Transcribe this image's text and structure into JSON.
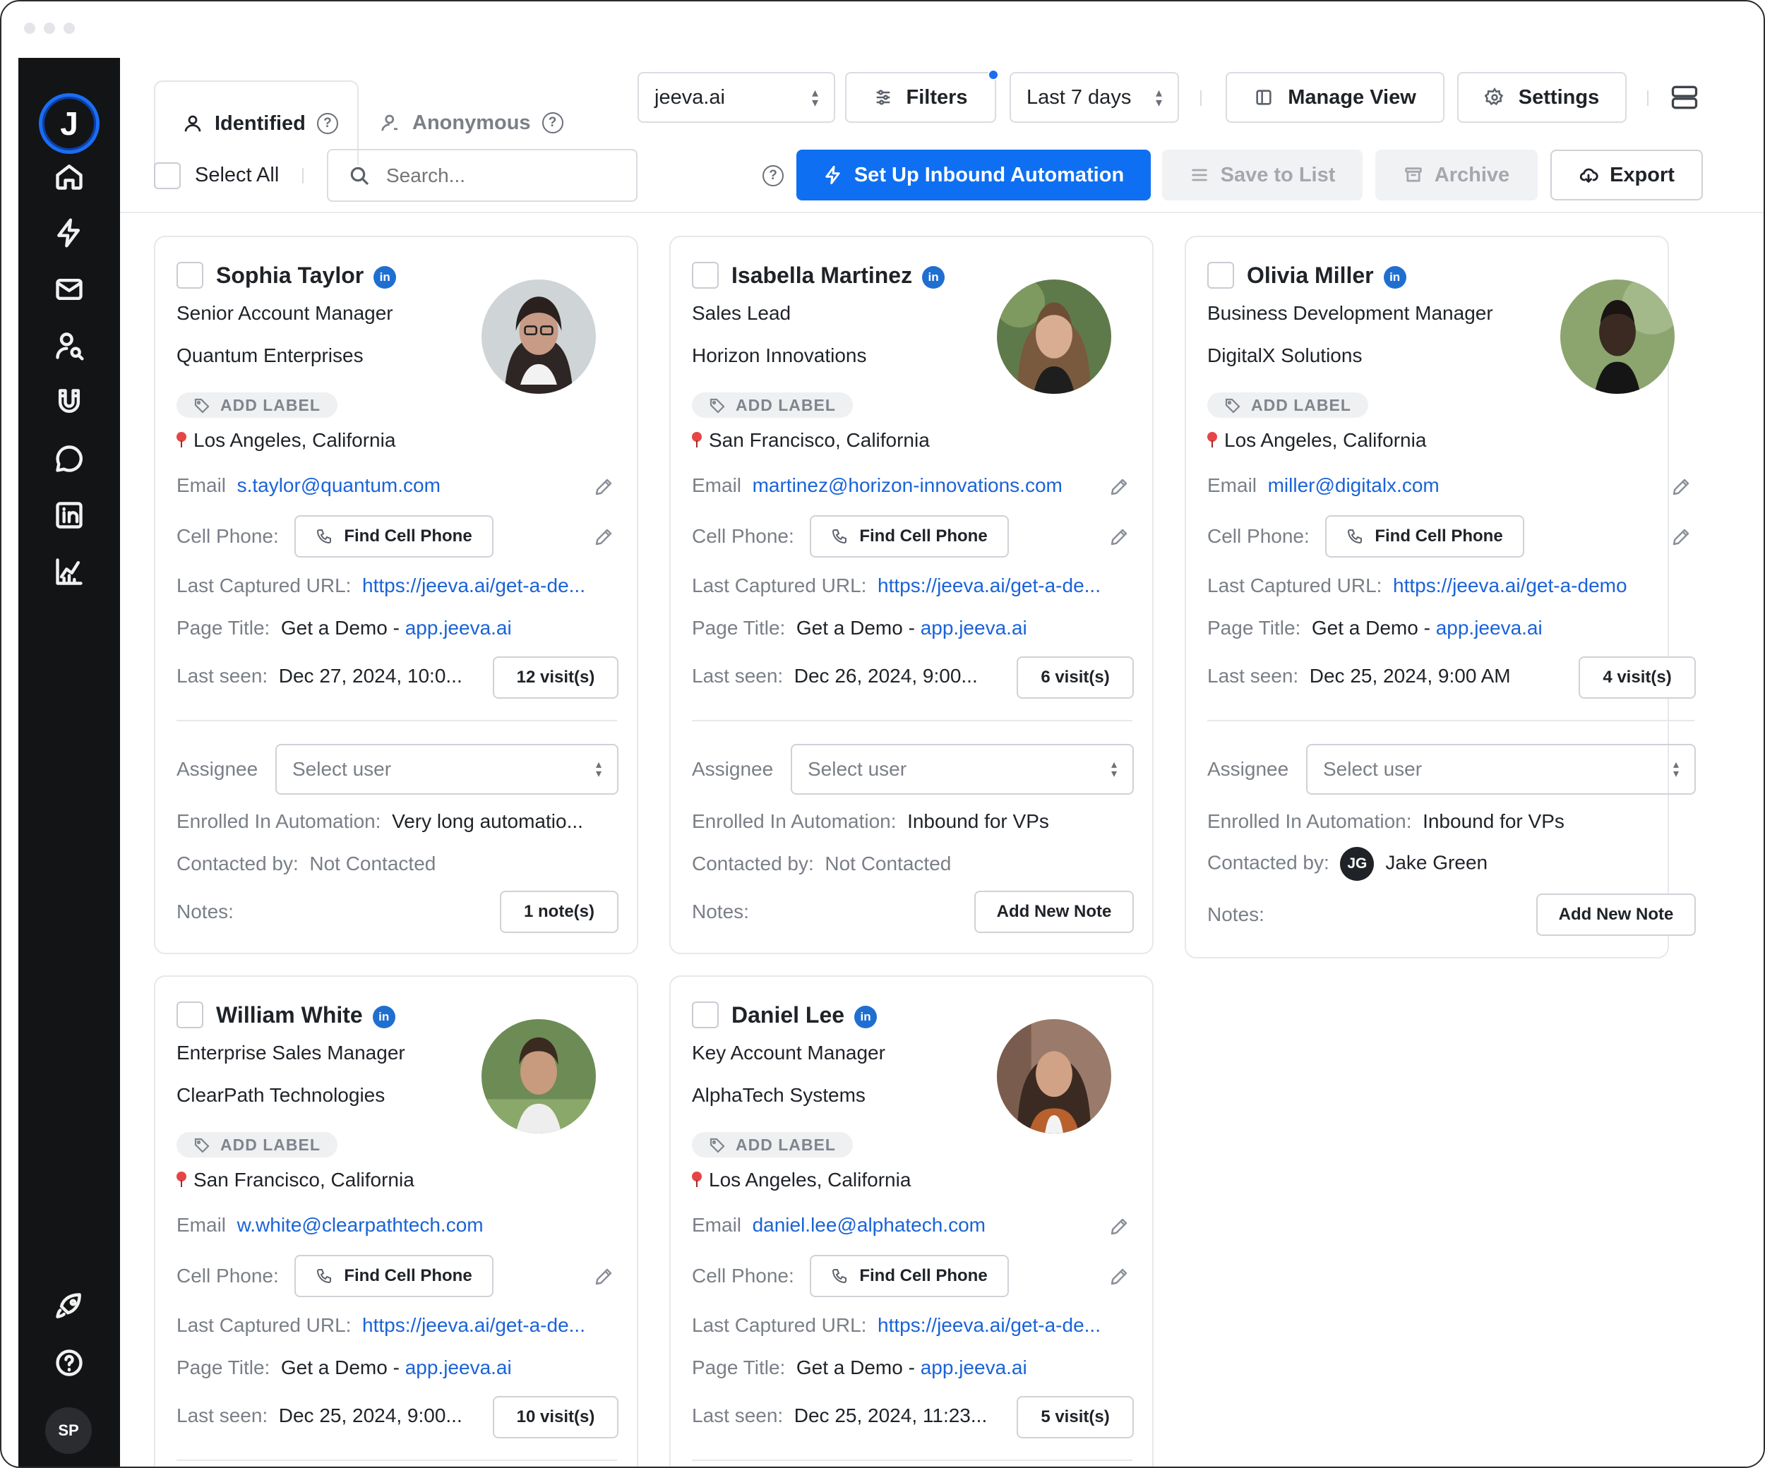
{
  "app": {
    "logo_letter": "J",
    "user_initials": "SP",
    "accent": "#1b6ef3"
  },
  "sidebar": {
    "items": [
      {
        "icon": "home-icon"
      },
      {
        "icon": "lightning-icon"
      },
      {
        "icon": "mail-icon"
      },
      {
        "icon": "person-search-icon"
      },
      {
        "icon": "magnet-icon"
      },
      {
        "icon": "chat-icon"
      },
      {
        "icon": "linkedin-icon"
      },
      {
        "icon": "chart-icon"
      },
      {
        "icon": "rocket-icon"
      },
      {
        "icon": "help-icon"
      }
    ]
  },
  "tabs": {
    "identified": "Identified",
    "anonymous": "Anonymous"
  },
  "toolbar": {
    "site": "jeeva.ai",
    "filters": "Filters",
    "date_range": "Last 7 days",
    "manage_view": "Manage View",
    "settings": "Settings",
    "select_all": "Select All",
    "search_placeholder": "Search...",
    "setup_automation": "Set Up Inbound Automation",
    "save_to_list": "Save to List",
    "archive": "Archive",
    "export": "Export"
  },
  "labels": {
    "add_label": "ADD LABEL",
    "email": "Email",
    "cell_phone": "Cell Phone:",
    "find_cell_phone": "Find Cell Phone",
    "last_url": "Last Captured URL:",
    "page_title": "Page Title:",
    "page_title_value": "Get a Demo - ",
    "page_title_link": "app.jeeva.ai",
    "last_seen": "Last seen:",
    "assignee": "Assignee",
    "select_user": "Select user",
    "enrolled": "Enrolled In Automation:",
    "contacted_by": "Contacted by:",
    "notes": "Notes:"
  },
  "contacts": [
    {
      "name": "Sophia Taylor",
      "title": "Senior Account Manager",
      "company": "Quantum Enterprises",
      "location": "Los Angeles, California",
      "email": "s.taylor@quantum.com",
      "url": "https://jeeva.ai/get-a-de...",
      "last_seen": "Dec 27, 2024, 10:0...",
      "visits": "12 visit(s)",
      "automation": "Very long automatio...",
      "contacted": "Not Contacted",
      "contacted_initials": "",
      "notes_btn": "1 note(s)"
    },
    {
      "name": "Isabella Martinez",
      "title": "Sales Lead",
      "company": "Horizon Innovations",
      "location": "San Francisco, California",
      "email": "martinez@horizon-innovations.com",
      "url": "https://jeeva.ai/get-a-de...",
      "last_seen": "Dec 26, 2024, 9:00...",
      "visits": "6 visit(s)",
      "automation": "Inbound for VPs",
      "contacted": "Not Contacted",
      "contacted_initials": "",
      "notes_btn": "Add New Note"
    },
    {
      "name": "Olivia Miller",
      "title": "Business Development Manager",
      "company": "DigitalX Solutions",
      "location": "Los Angeles, California",
      "email": "miller@digitalx.com",
      "url": "https://jeeva.ai/get-a-demo",
      "last_seen": "Dec 25, 2024, 9:00 AM",
      "visits": "4 visit(s)",
      "automation": "Inbound for VPs",
      "contacted": "Jake Green",
      "contacted_initials": "JG",
      "notes_btn": "Add New Note"
    },
    {
      "name": "William White",
      "title": "Enterprise Sales Manager",
      "company": "ClearPath Technologies",
      "location": "San Francisco, California",
      "email": "w.white@clearpathtech.com",
      "url": "https://jeeva.ai/get-a-de...",
      "last_seen": "Dec 25, 2024, 9:00...",
      "visits": "10 visit(s)"
    },
    {
      "name": "Daniel Lee",
      "title": "Key Account Manager",
      "company": "AlphaTech Systems",
      "location": "Los Angeles, California",
      "email": "daniel.lee@alphatech.com",
      "url": "https://jeeva.ai/get-a-de...",
      "last_seen": "Dec 25, 2024, 11:23...",
      "visits": "5 visit(s)"
    }
  ]
}
